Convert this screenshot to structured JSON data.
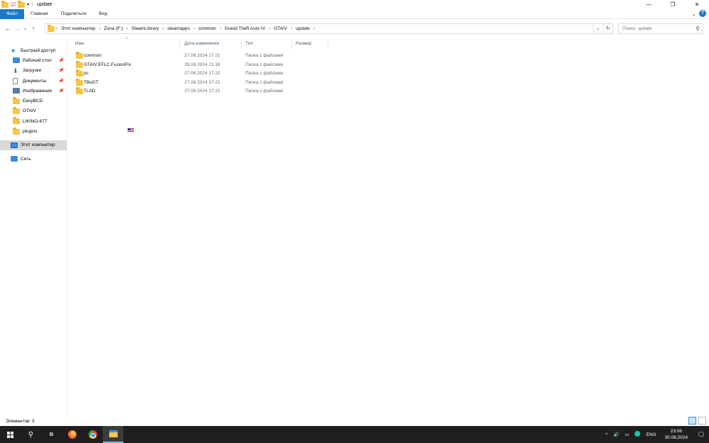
{
  "window": {
    "title": "update",
    "minimize": "—",
    "restore": "❐",
    "close": "✕"
  },
  "ribbon": {
    "tabs": [
      "Файл",
      "Главная",
      "Поделиться",
      "Вид"
    ],
    "expand": "⌄",
    "help": "?"
  },
  "address": {
    "back": "←",
    "forward": "→",
    "recent": "⌄",
    "up": "↑",
    "crumbs": [
      "Этот компьютер",
      "Zona (F:)",
      "SteamLibrary",
      "steamapps",
      "common",
      "Grand Theft Auto IV",
      "GTAIV",
      "update"
    ],
    "dropdown": "⌄",
    "refresh": "↻",
    "search_placeholder": "Поиск: update"
  },
  "nav": {
    "quick_access": "Быстрый доступ",
    "pinned": [
      {
        "label": "Рабочий стол",
        "icon": "desktop-icon"
      },
      {
        "label": "Загрузки",
        "icon": "downloads-icon"
      },
      {
        "label": "Документы",
        "icon": "documents-icon"
      },
      {
        "label": "Изображения",
        "icon": "pictures-icon"
      }
    ],
    "folders": [
      "EasyBCD",
      "GTAIV",
      "LIKINO-677",
      "plugins"
    ],
    "this_pc": "Этот компьютер",
    "network": "Сеть"
  },
  "columns": {
    "name": "Имя",
    "date": "Дата изменения",
    "type": "Тип",
    "size": "Размер"
  },
  "files": [
    {
      "name": "common",
      "date": "27.08.2024 17:22",
      "type": "Папка с файлами"
    },
    {
      "name": "GTAIV.EFLC.FusionFix",
      "date": "28.08.2024 21:16",
      "type": "Папка с файлами"
    },
    {
      "name": "pc",
      "date": "27.08.2024 17:22",
      "type": "Папка с файлами"
    },
    {
      "name": "TBoGT",
      "date": "27.08.2024 17:22",
      "type": "Папка с файлами"
    },
    {
      "name": "TLAD",
      "date": "27.08.2024 17:22",
      "type": "Папка с файлами"
    }
  ],
  "status": {
    "items": "Элементов: 5"
  },
  "taskbar": {
    "lang": "ENG",
    "time": "23:06",
    "date": "30.08.2024",
    "chevron": "^",
    "volume": "🔊"
  }
}
